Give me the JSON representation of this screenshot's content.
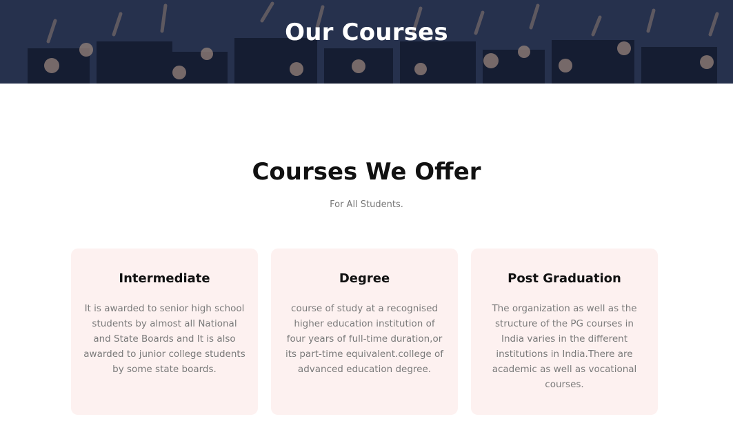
{
  "hero": {
    "title": "Our Courses"
  },
  "section": {
    "title": "Courses We Offer",
    "subtitle": "For All Students."
  },
  "cards": [
    {
      "title": "Intermediate",
      "text": "It is awarded to senior high school students by almost all National and State Boards and It is also awarded to junior college students by some state boards."
    },
    {
      "title": "Degree",
      "text": "course of study at a recognised higher education institution of four years of full-time duration,or its part-time equivalent.college of advanced education degree."
    },
    {
      "title": "Post Graduation",
      "text": "The organization as well as the structure of the PG courses in India varies in the different institutions in India.There are academic as well as vocational courses."
    }
  ],
  "colors": {
    "hero_bg": "#26324e",
    "card_bg": "#fdf1f0",
    "heading": "#111111",
    "body_text": "#7a7a7a"
  }
}
